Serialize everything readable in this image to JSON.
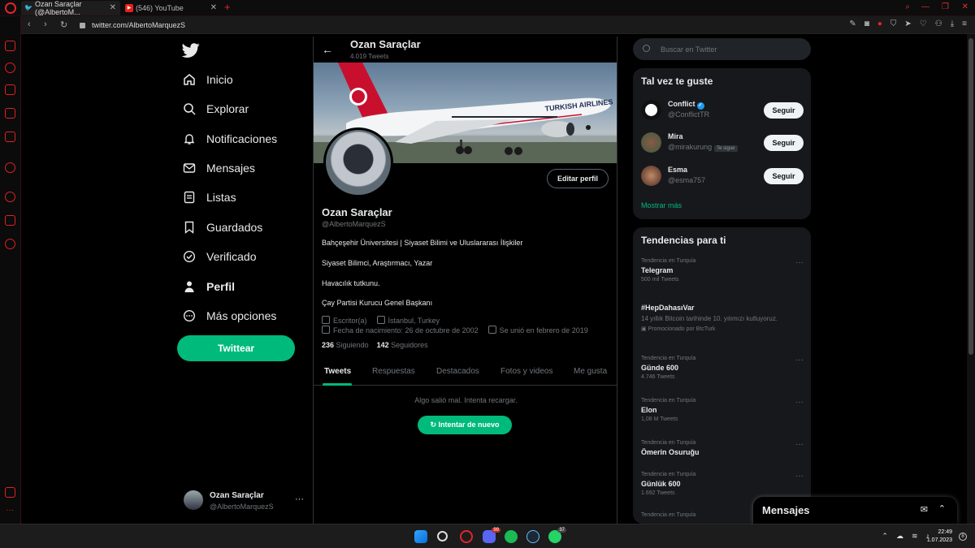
{
  "browser": {
    "tabs": [
      {
        "title": "Ozan Saraçlar (@AlbertoM..."
      },
      {
        "title": "(546) YouTube"
      }
    ],
    "url": "twitter.com/AlbertoMarquezS"
  },
  "nav": {
    "items": [
      {
        "label": "Inicio",
        "icon": "home-icon"
      },
      {
        "label": "Explorar",
        "icon": "search-icon"
      },
      {
        "label": "Notificaciones",
        "icon": "bell-icon"
      },
      {
        "label": "Mensajes",
        "icon": "mail-icon"
      },
      {
        "label": "Listas",
        "icon": "list-icon"
      },
      {
        "label": "Guardados",
        "icon": "bookmark-icon"
      },
      {
        "label": "Verificado",
        "icon": "verified-icon"
      },
      {
        "label": "Perfil",
        "icon": "person-icon"
      },
      {
        "label": "Más opciones",
        "icon": "more-circle-icon"
      }
    ],
    "tweet_button": "Twittear",
    "account": {
      "name": "Ozan Saraçlar",
      "handle": "@AlbertoMarquezS"
    }
  },
  "profile": {
    "header_name": "Ozan Saraçlar",
    "tweet_count": "4.019 Tweets",
    "edit_button": "Editar perfil",
    "name": "Ozan Saraçlar",
    "handle": "@AlbertoMarquezS",
    "bio": [
      "Bahçeşehir Üniversitesi | Siyaset Bilimi ve Uluslararası İlişkiler",
      "Siyaset Bilimci, Araştırmacı, Yazar",
      "Havacılık tutkunu.",
      "Çay Partisi Kurucu Genel Başkanı"
    ],
    "category": "Escritor(a)",
    "location": "İstanbul, Turkey",
    "birthdate": "Fecha de nacimiento: 26 de octubre de 2002",
    "joined": "Se unió en febrero de 2019",
    "following_count": "236",
    "following_label": "Siguiendo",
    "followers_count": "142",
    "followers_label": "Seguidores",
    "tabs": [
      "Tweets",
      "Respuestas",
      "Destacados",
      "Fotos y videos",
      "Me gusta"
    ],
    "error_message": "Algo salió mal. Intenta recargar.",
    "retry_button": "Intentar de nuevo",
    "banner_text": "TURKISH AIRLINES"
  },
  "search": {
    "placeholder": "Buscar en Twitter"
  },
  "who_to_follow": {
    "title": "Tal vez te guste",
    "users": [
      {
        "name": "Conflict",
        "handle": "@ConflictTR",
        "verified": true
      },
      {
        "name": "Mira",
        "handle": "@mirakurung",
        "follows_you": "Te sigue"
      },
      {
        "name": "Esma",
        "handle": "@esma757"
      }
    ],
    "follow_label": "Seguir",
    "show_more": "Mostrar más"
  },
  "trends": {
    "title": "Tendencias para ti",
    "items": [
      {
        "context": "Tendencia en Turquía",
        "topic": "Telegram",
        "count": "500 mil Tweets"
      },
      {
        "context": "",
        "topic": "#HepDahasıVar",
        "desc": "14 yıllık Bitcoin tarihinde 10. yılımızı kutluyoruz.",
        "promo": "Promocionado por BtcTurk"
      },
      {
        "context": "Tendencia en Turquía",
        "topic": "Günde 600",
        "count": "4.746 Tweets"
      },
      {
        "context": "Tendencia en Turquía",
        "topic": "Elon",
        "count": "1,08 M Tweets"
      },
      {
        "context": "Tendencia en Turquía",
        "topic": "Ömerin Osuruğu",
        "count": ""
      },
      {
        "context": "Tendencia en Turquía",
        "topic": "Günlük 600",
        "count": "1.692 Tweets"
      },
      {
        "context": "Tendencia en Turquía",
        "topic": "",
        "count": ""
      }
    ]
  },
  "messages_dock": {
    "title": "Mensajes"
  },
  "taskbar": {
    "time": "22:49",
    "date": "1.07.2023",
    "discord_badge": "99",
    "whatsapp_badge": "37"
  },
  "colors": {
    "accent": "#00ba7c",
    "browser_red": "#e2242f",
    "twitter_blue": "#1d9bf0"
  }
}
